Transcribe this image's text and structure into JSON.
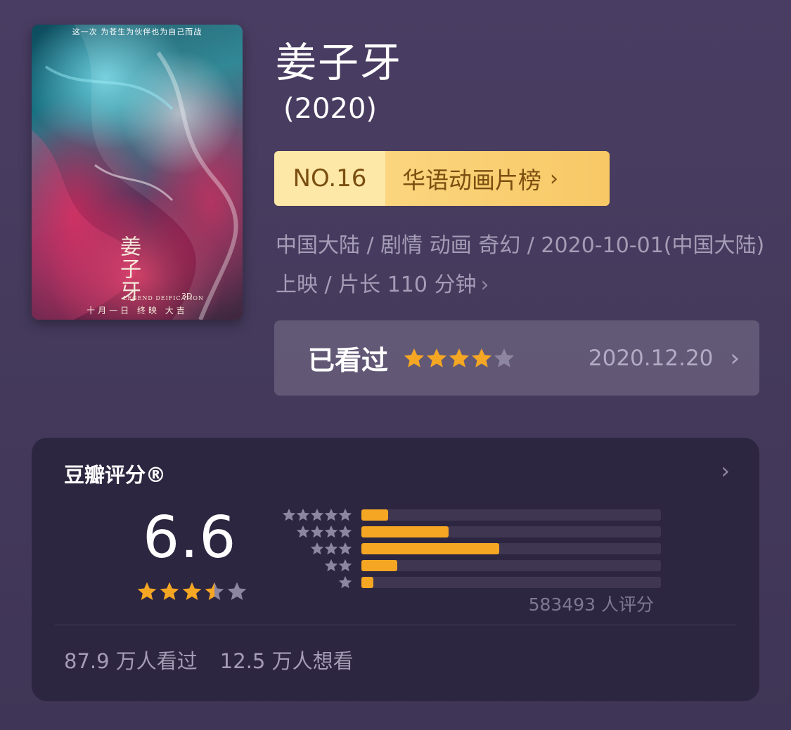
{
  "movie": {
    "title": "姜子牙",
    "year": "(2020)",
    "poster": {
      "tagline": "这一次 为苍生为伙伴也为自己而战",
      "title_art": "姜子牙",
      "subtitle": "LEGEND DEIFICATION",
      "format": "3D",
      "release_text": "十月一日 终映 大吉"
    },
    "rank": {
      "number": "NO.16",
      "list_name": "华语动画片榜",
      "chevron": "›"
    },
    "meta_text": "中国大陆 / 剧情 动画 奇幻 / 2020-10-01(中国大陆) 上映 / 片长 110 分钟",
    "meta_chevron": "›"
  },
  "user_status": {
    "label": "已看过",
    "stars": 4,
    "date": "2020.12.20",
    "chevron": "›"
  },
  "rating": {
    "header": "豆瓣评分®",
    "header_chevron": "›",
    "score": "6.6",
    "stars": 3.5,
    "distribution": [
      {
        "stars": 5,
        "fraction": 0.09
      },
      {
        "stars": 4,
        "fraction": 0.29
      },
      {
        "stars": 3,
        "fraction": 0.46
      },
      {
        "stars": 2,
        "fraction": 0.12
      },
      {
        "stars": 1,
        "fraction": 0.04
      }
    ],
    "count_text": "583493 人评分",
    "watched_text": "87.9 万人看过",
    "want_text": "12.5 万人想看"
  },
  "colors": {
    "star_filled": "#f5a623",
    "star_empty": "#8d86a0",
    "bar_fill": "#f5a623",
    "bar_track": "#3f3752"
  }
}
